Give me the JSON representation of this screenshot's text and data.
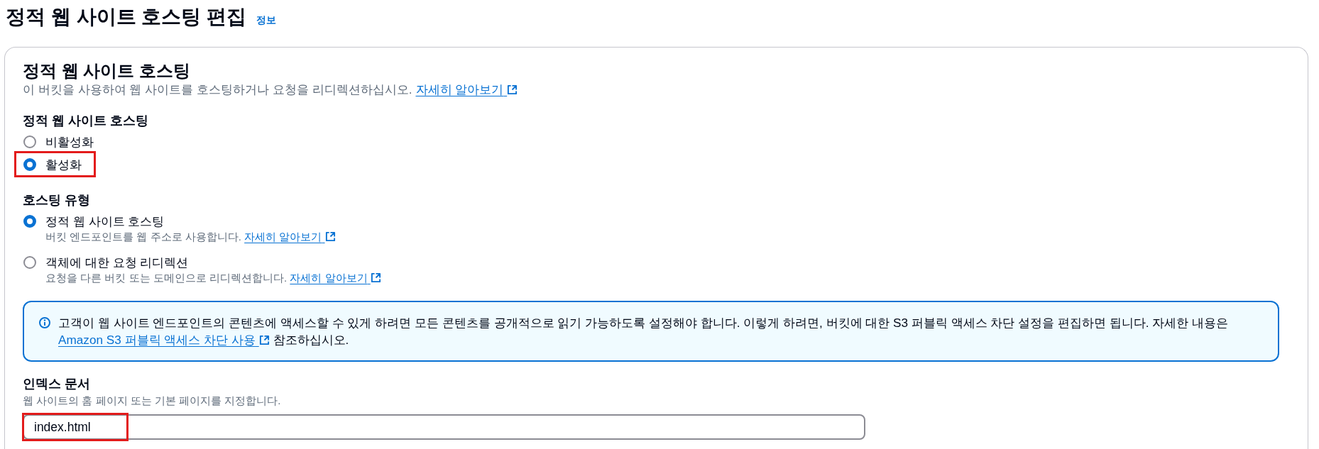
{
  "page": {
    "title": "정적 웹 사이트 호스팅 편집",
    "info_link": "정보"
  },
  "card": {
    "title": "정적 웹 사이트 호스팅",
    "description": "이 버킷을 사용하여 웹 사이트를 호스팅하거나 요청을 리디렉션하십시오.",
    "link": "자세히 알아보기"
  },
  "static_website_hosting": {
    "label": "정적 웹 사이트 호스팅",
    "options": [
      {
        "label": "비활성화",
        "selected": false,
        "highlighted": false
      },
      {
        "label": "활성화",
        "selected": true,
        "highlighted": true
      }
    ]
  },
  "hosting_type": {
    "label": "호스팅 유형",
    "options": [
      {
        "label": "정적 웹 사이트 호스팅",
        "description": "버킷 엔드포인트를 웹 주소로 사용합니다.",
        "link": "자세히 알아보기",
        "selected": true,
        "highlighted": false
      },
      {
        "label": "객체에 대한 요청 리디렉션",
        "description": "요청을 다른 버킷 또는 도메인으로 리디렉션합니다.",
        "link": "자세히 알아보기",
        "selected": false,
        "highlighted": false
      }
    ]
  },
  "info_alert": {
    "text": "고객이 웹 사이트 엔드포인트의 콘텐츠에 액세스할 수 있게 하려면 모든 콘텐츠를 공개적으로 읽기 가능하도록 설정해야 합니다. 이렇게 하려면, 버킷에 대한 S3 퍼블릭 액세스 차단 설정을 편집하면 됩니다. 자세한 내용은",
    "link": "Amazon S3 퍼블릭 액세스 차단 사용",
    "text_after": "참조하십시오."
  },
  "index_document": {
    "label": "인덱스 문서",
    "description": "웹 사이트의 홈 페이지 또는 기본 페이지를 지정합니다.",
    "value": "index.html",
    "highlighted": true
  }
}
